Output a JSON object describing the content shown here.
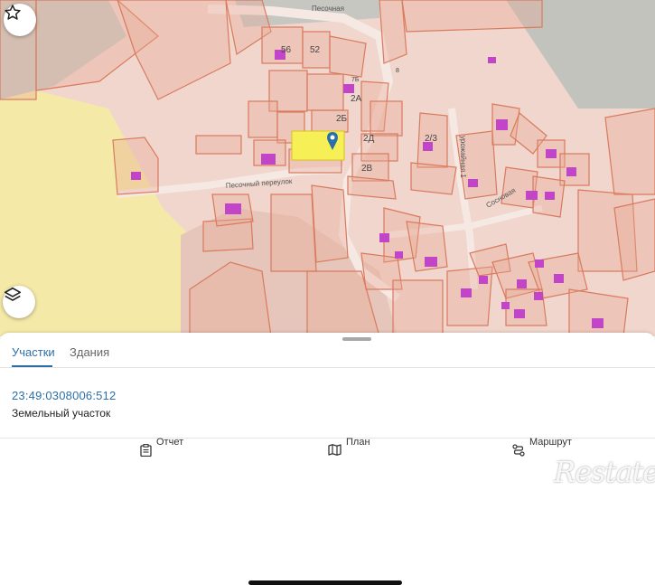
{
  "map": {
    "street_pesochnaya": "Песочная",
    "street_urozhainaya": "урожайная 1",
    "lane_pesochny": "Песочный переулок",
    "street_sosnovaya": "Сосновая",
    "house_numbers": [
      "56",
      "52",
      "2Б",
      "2Д",
      "2/3",
      "2В",
      "2А",
      "8",
      "7Б"
    ],
    "selected_parcel_color": "#f6f056",
    "parcel_border_color": "#d97a5e",
    "building_color": "#c244c8",
    "marker_color": "#2c6fa6"
  },
  "controls": {
    "favorite_icon": "star-icon",
    "layers_icon": "layers-icon"
  },
  "sheet": {
    "tabs": [
      "Участки",
      "Здания"
    ],
    "active_tab": "Участки",
    "parcel": {
      "cadastral_number": "23:49:0308006:512",
      "type": "Земельный участок"
    }
  },
  "bottom_nav": {
    "report": "Отчет",
    "plan": "План",
    "route": "Маршрут"
  },
  "watermark": "Restate"
}
